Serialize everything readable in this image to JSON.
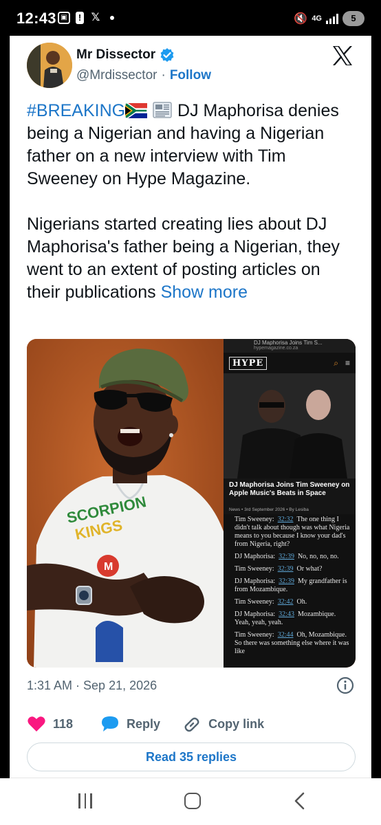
{
  "status_bar": {
    "time": "12:43",
    "network": "4G",
    "battery": "5"
  },
  "tweet": {
    "author_name": "Mr Dissector",
    "handle": "@Mrdissector",
    "separator": "·",
    "follow_label": "Follow",
    "hashtag": "#BREAKING",
    "text_p1": "DJ Maphorisa denies being a Nigerian and having a Nigerian father on a new interview with Tim Sweeney on Hype Magazine.",
    "text_p2": "Nigerians started creating lies about DJ Maphorisa's father being a Nigerian, they went to an extent of posting articles on their publications",
    "show_more": "Show more",
    "timestamp": "1:31 AM · Sep 21, 2026",
    "likes": "118",
    "reply_label": "Reply",
    "copy_link_label": "Copy link",
    "read_replies_label": "Read 35 replies"
  },
  "media": {
    "shirt_text": "SCORPION KINGS",
    "screenshot": {
      "tab_title": "DJ Maphorisa Joins Tim S...",
      "url": "hypemagazine.co.za",
      "logo": "HYPE",
      "headline": "DJ Maphorisa Joins Tim Sweeney on Apple Music's Beats in Space",
      "meta": "News • 3rd September 2026 • By Lesiba",
      "transcript": [
        {
          "speaker": "Tim Sweeney:",
          "ts": "32:32",
          "text": "The one thing I didn't talk about though was what Nigeria means to you because I know your dad's from Nigeria, right?"
        },
        {
          "speaker": "DJ Maphorisa:",
          "ts": "32:39",
          "text": "No, no, no, no."
        },
        {
          "speaker": "Tim Sweeney:",
          "ts": "32:39",
          "text": "Or what?"
        },
        {
          "speaker": "DJ Maphorisa:",
          "ts": "32:39",
          "text": "My grandfather is from Mozambique."
        },
        {
          "speaker": "Tim Sweeney:",
          "ts": "32:42",
          "text": "Oh."
        },
        {
          "speaker": "DJ Maphorisa:",
          "ts": "32:43",
          "text": "Mozambique. Yeah, yeah, yeah."
        },
        {
          "speaker": "Tim Sweeney:",
          "ts": "32:44",
          "text": "Oh, Mozambique. So there was something else where it was like"
        }
      ]
    }
  },
  "icons": [
    "verified-badge-icon",
    "x-logo-icon",
    "south-africa-flag-icon",
    "newspaper-icon",
    "info-icon",
    "heart-icon",
    "reply-bubble-icon",
    "link-icon"
  ],
  "colors": {
    "link_blue": "#1d76c8",
    "heart_pink": "#f91880",
    "text_primary": "#0f1419",
    "text_secondary": "#536471"
  }
}
